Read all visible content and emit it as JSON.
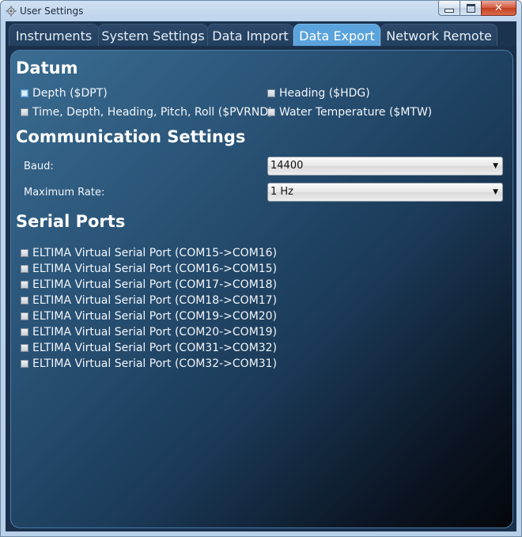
{
  "window": {
    "title": "User Settings"
  },
  "tabs": [
    "Instruments",
    "System Settings",
    "Data Import",
    "Data Export",
    "Network Remote"
  ],
  "active_tab": "Data Export",
  "datum": {
    "heading": "Datum",
    "items": [
      {
        "label": "Depth ($DPT)",
        "checked": true
      },
      {
        "label": "Heading ($HDG)",
        "checked": false
      },
      {
        "label": "Time, Depth, Heading, Pitch, Roll ($PVRND)",
        "checked": false
      },
      {
        "label": "Water Temperature ($MTW)",
        "checked": false
      }
    ]
  },
  "communication": {
    "heading": "Communication Settings",
    "baud_label": "Baud:",
    "baud_value": "14400",
    "rate_label": "Maximum Rate:",
    "rate_value": "1 Hz"
  },
  "serial": {
    "heading": "Serial Ports",
    "ports": [
      {
        "label": "ELTIMA Virtual Serial Port (COM15->COM16)",
        "checked": false
      },
      {
        "label": "ELTIMA Virtual Serial Port (COM16->COM15)",
        "checked": false
      },
      {
        "label": "ELTIMA Virtual Serial Port (COM17->COM18)",
        "checked": false
      },
      {
        "label": "ELTIMA Virtual Serial Port (COM18->COM17)",
        "checked": false
      },
      {
        "label": "ELTIMA Virtual Serial Port (COM19->COM20)",
        "checked": false
      },
      {
        "label": "ELTIMA Virtual Serial Port (COM20->COM19)",
        "checked": false
      },
      {
        "label": "ELTIMA Virtual Serial Port (COM31->COM32)",
        "checked": false
      },
      {
        "label": "ELTIMA Virtual Serial Port (COM32->COM31)",
        "checked": false
      }
    ]
  }
}
